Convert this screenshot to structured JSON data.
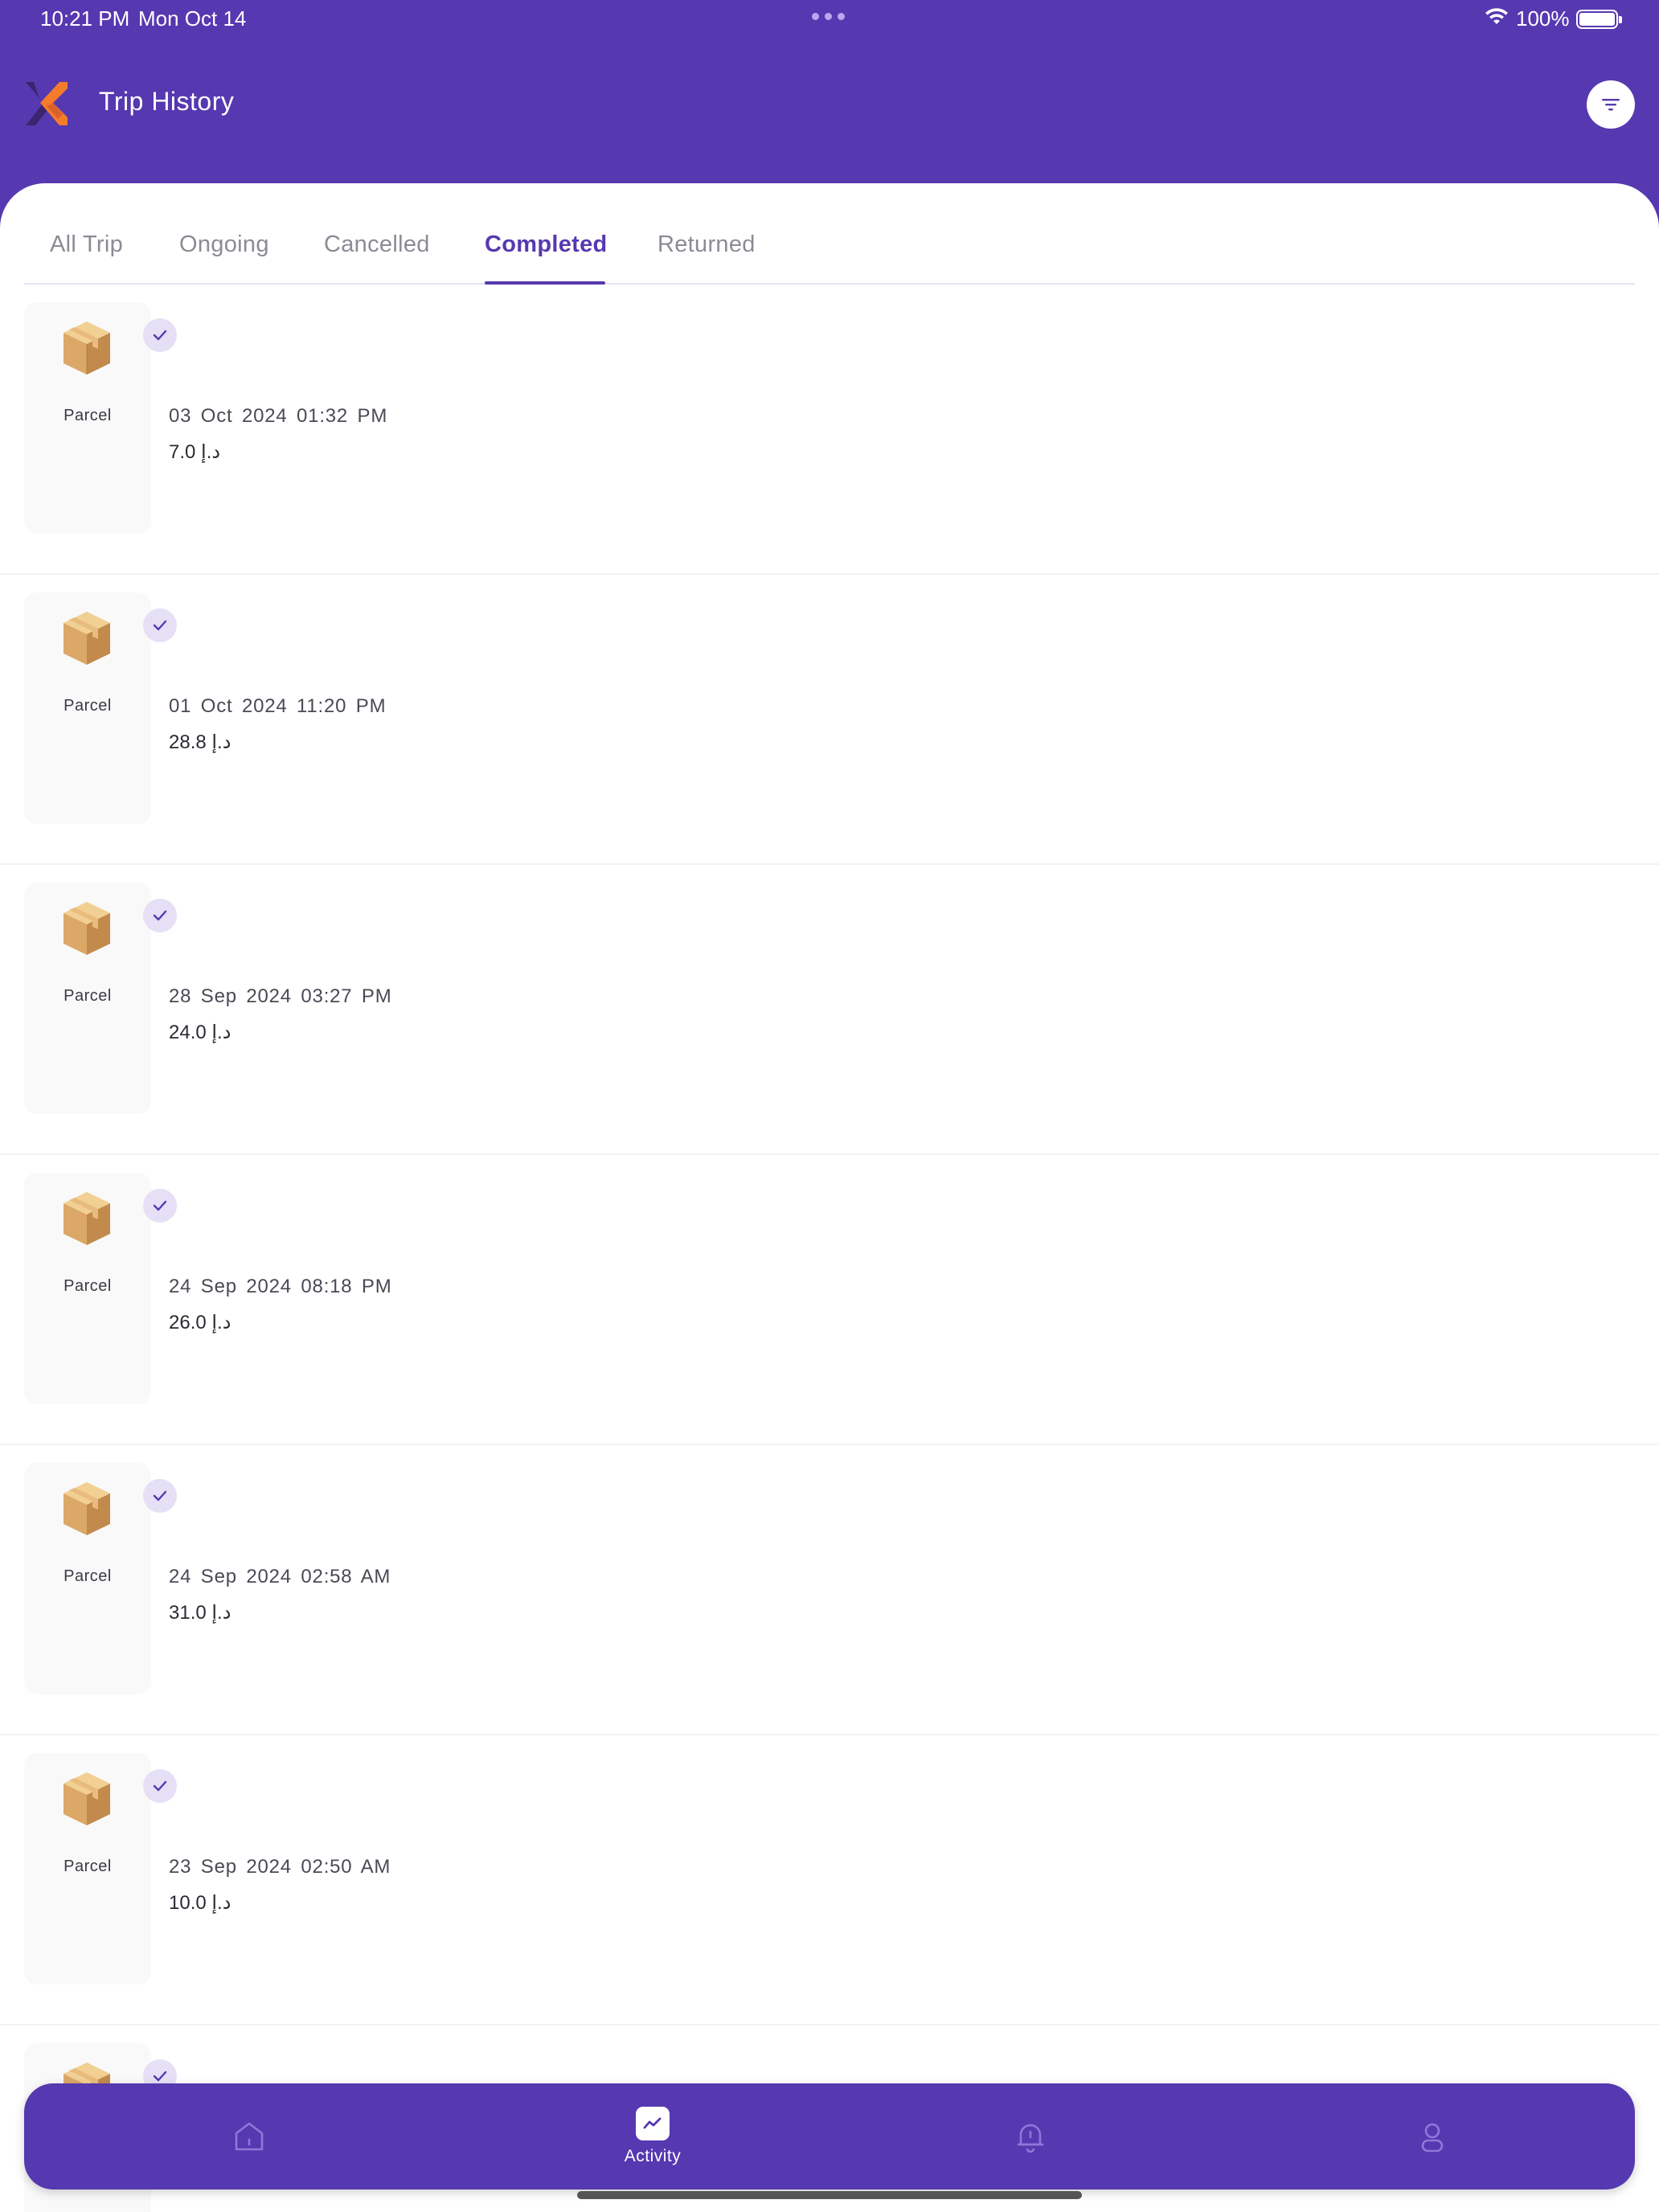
{
  "status_bar": {
    "time": "10:21 PM",
    "date": "Mon Oct 14",
    "battery": "100%",
    "icons": [
      "wifi-icon",
      "battery-icon"
    ]
  },
  "header": {
    "title": "Trip History",
    "logo": "app-logo",
    "filter_icon": "filter-icon"
  },
  "tabs": [
    {
      "label": "All Trip",
      "active": false
    },
    {
      "label": "Ongoing",
      "active": false
    },
    {
      "label": "Cancelled",
      "active": false
    },
    {
      "label": "Completed",
      "active": true
    },
    {
      "label": "Returned",
      "active": false
    }
  ],
  "trips": [
    {
      "type": "Parcel",
      "datetime": "03 Oct 2024  01:32 PM",
      "price": "7.0 د.إ",
      "status_icon": "check-icon"
    },
    {
      "type": "Parcel",
      "datetime": "01 Oct 2024  11:20 PM",
      "price": "28.8 د.إ",
      "status_icon": "check-icon"
    },
    {
      "type": "Parcel",
      "datetime": "28 Sep 2024  03:27 PM",
      "price": "24.0 د.إ",
      "status_icon": "check-icon"
    },
    {
      "type": "Parcel",
      "datetime": "24 Sep 2024  08:18 PM",
      "price": "26.0 د.إ",
      "status_icon": "check-icon"
    },
    {
      "type": "Parcel",
      "datetime": "24 Sep 2024  02:58 AM",
      "price": "31.0 د.إ",
      "status_icon": "check-icon"
    },
    {
      "type": "Parcel",
      "datetime": "23 Sep 2024  02:50 AM",
      "price": "10.0 د.إ",
      "status_icon": "check-icon"
    },
    {
      "type": "",
      "datetime": "",
      "price": "",
      "status_icon": "check-icon"
    }
  ],
  "bottom_nav": {
    "items": [
      {
        "icon": "home-icon",
        "label": ""
      },
      {
        "icon": "activity-icon",
        "label": "Activity",
        "active": true
      },
      {
        "icon": "bell-icon",
        "label": ""
      },
      {
        "icon": "profile-icon",
        "label": ""
      }
    ]
  },
  "colors": {
    "brand": "#5638b0",
    "accent_orange": "#f47b2a",
    "tab_inactive": "#8b8b95"
  }
}
